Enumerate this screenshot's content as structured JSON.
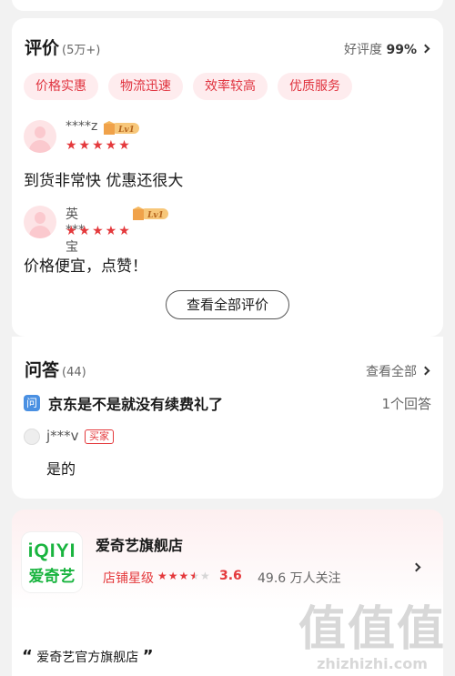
{
  "reviews": {
    "title": "评价",
    "count": "(5万+)",
    "rating_label": "好评度",
    "rating_value": "99%",
    "tags": [
      "价格实惠",
      "物流迅速",
      "效率较高",
      "优质服务"
    ],
    "items": [
      {
        "user": "****z",
        "level": "Lv1",
        "stars": "★★★★★",
        "text": "到货非常快  优惠还很大"
      },
      {
        "user": "英***宝",
        "level": "Lv1",
        "stars": "★★★★★",
        "text": "价格便宜，点赞！"
      }
    ],
    "all_button": "查看全部评价"
  },
  "qa": {
    "title": "问答",
    "count": "(44)",
    "view_all": "查看全部",
    "q_icon": "问",
    "question": "京东是不是就没有续费礼了",
    "answer_count": "1个回答",
    "answer_user": "j***v",
    "buyer_badge": "买家",
    "answer": "是的"
  },
  "store": {
    "logo_line1": "iQIYI",
    "logo_line2": "爱奇艺",
    "name": "爱奇艺旗舰店",
    "rating_label": "店铺星级",
    "rating_stars_on": "★★★",
    "rating_stars_half": "★",
    "rating_stars_off": "★",
    "score": "3.6",
    "followers": "49.6 万人关注",
    "quote_open": "“",
    "quote": "爱奇艺官方旗舰店",
    "quote_close": "”"
  },
  "watermark": {
    "line1": "值值值",
    "line2": "zhizhizhi.com"
  }
}
